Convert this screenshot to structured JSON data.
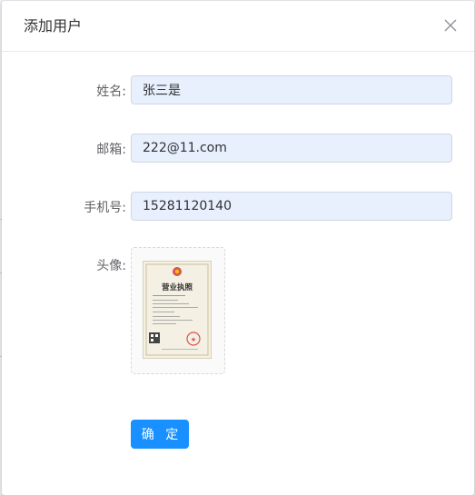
{
  "dialog": {
    "title": "添加用户",
    "close_icon": "close-icon"
  },
  "form": {
    "name": {
      "label": "姓名:",
      "value": "张三是"
    },
    "email": {
      "label": "邮箱:",
      "value": "222@11.com"
    },
    "phone": {
      "label": "手机号:",
      "value": "15281120140"
    },
    "avatar": {
      "label": "头像:",
      "image_alt": "营业执照"
    }
  },
  "actions": {
    "confirm_label": "确 定"
  },
  "colors": {
    "primary": "#1890ff",
    "input_bg": "#e8f0fe"
  }
}
